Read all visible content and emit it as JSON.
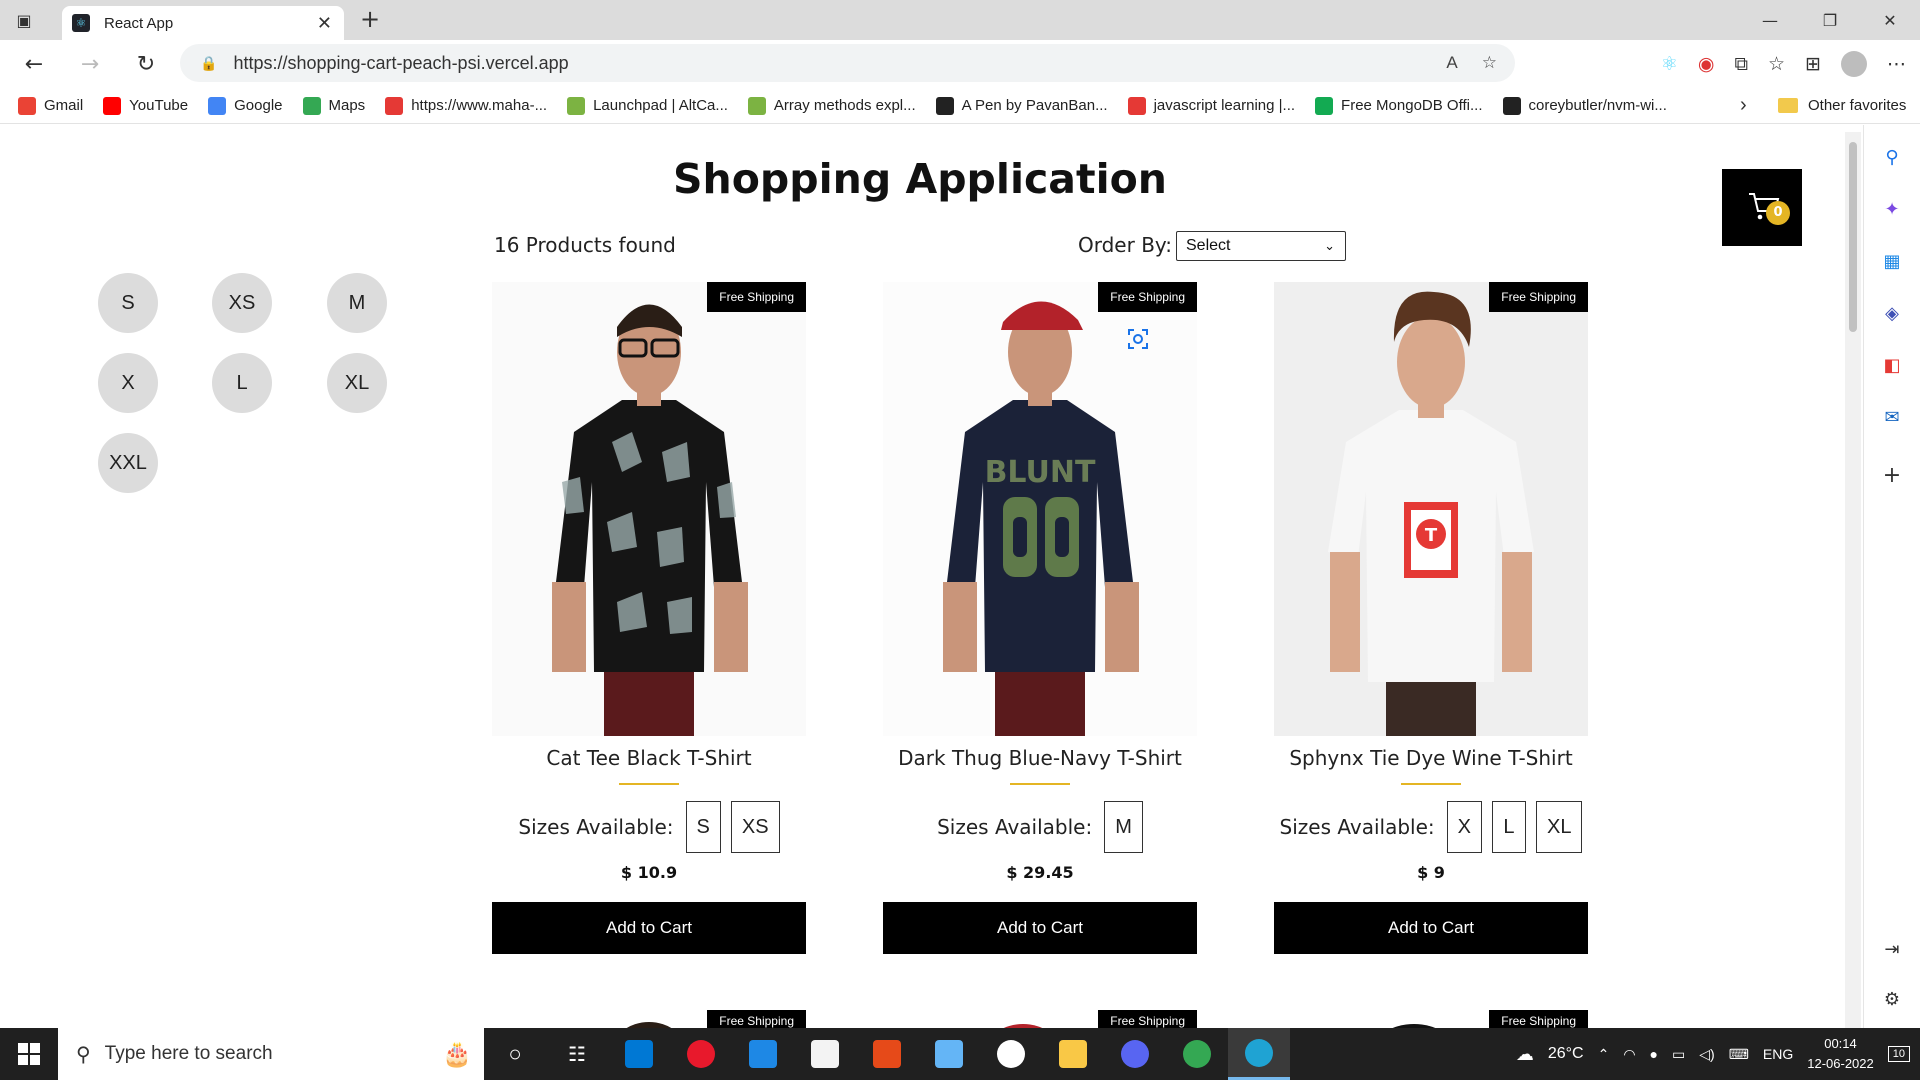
{
  "browser": {
    "tab_title": "React App",
    "tab_close": "✕",
    "new_tab": "+",
    "url": "https://shopping-cart-peach-psi.vercel.app"
  },
  "bookmarks": [
    {
      "label": "Gmail",
      "color": "#ea4335"
    },
    {
      "label": "YouTube",
      "color": "#ff0000"
    },
    {
      "label": "Google",
      "color": "#4285f4"
    },
    {
      "label": "Maps",
      "color": "#34a853"
    },
    {
      "label": "https://www.maha-...",
      "color": "#e53935"
    },
    {
      "label": "Launchpad | AltCa...",
      "color": "#7cb342"
    },
    {
      "label": "Array methods expl...",
      "color": "#7cb342"
    },
    {
      "label": "A Pen by PavanBan...",
      "color": "#222222"
    },
    {
      "label": "javascript learning |...",
      "color": "#e53935"
    },
    {
      "label": "Free MongoDB Offi...",
      "color": "#13aa52"
    },
    {
      "label": "coreybutler/nvm-wi...",
      "color": "#222222"
    }
  ],
  "bookmarks_other": "Other favorites",
  "page": {
    "title": "Shopping Application",
    "products_found": "16 Products found",
    "order_by_label": "Order By:",
    "order_by_value": "Select",
    "cart_count": "0"
  },
  "size_filters": [
    "S",
    "XS",
    "M",
    "X",
    "L",
    "XL",
    "XXL"
  ],
  "products": [
    {
      "name": "Cat Tee Black T-Shirt",
      "sizes_label": "Sizes Available:",
      "sizes": [
        "S",
        "XS"
      ],
      "price": "$ 10.9",
      "badge": "Free Shipping",
      "button": "Add to Cart",
      "shirt_color": "#151515",
      "pattern": "cat"
    },
    {
      "name": "Dark Thug Blue-Navy T-Shirt",
      "sizes_label": "Sizes Available:",
      "sizes": [
        "M"
      ],
      "price": "$ 29.45",
      "badge": "Free Shipping",
      "button": "Add to Cart",
      "shirt_color": "#1b2238",
      "pattern": "print"
    },
    {
      "name": "Sphynx Tie Dye Wine T-Shirt",
      "sizes_label": "Sizes Available:",
      "sizes": [
        "X",
        "L",
        "XL"
      ],
      "price": "$ 9",
      "badge": "Free Shipping",
      "button": "Add to Cart",
      "shirt_color": "#f4f4f4",
      "pattern": "logo"
    }
  ],
  "next_row_badge": "Free Shipping",
  "taskbar": {
    "search_placeholder": "Type here to search",
    "temperature": "26°C",
    "language": "ENG",
    "time": "00:14",
    "date": "12-06-2022",
    "notifications": "10"
  }
}
